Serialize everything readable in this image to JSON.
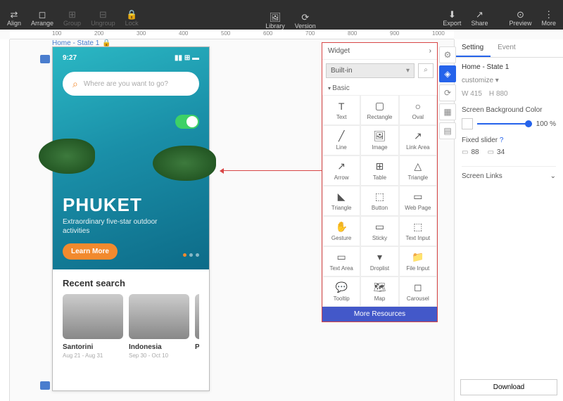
{
  "topbar": {
    "left": [
      {
        "icon": "⇄",
        "label": "Align"
      },
      {
        "icon": "◻",
        "label": "Arrange"
      },
      {
        "icon": "⊞",
        "label": "Group",
        "muted": true
      },
      {
        "icon": "⊟",
        "label": "Ungroup",
        "muted": true
      },
      {
        "icon": "🔒",
        "label": "Lock",
        "muted": true
      }
    ],
    "center": [
      {
        "icon": "🖼",
        "label": "Library"
      },
      {
        "icon": "⟳",
        "label": "Version"
      }
    ],
    "right1": [
      {
        "icon": "⬇",
        "label": "Export"
      },
      {
        "icon": "↗",
        "label": "Share"
      }
    ],
    "right2": [
      {
        "icon": "⊙",
        "label": "Preview"
      },
      {
        "icon": "⋮",
        "label": "More"
      }
    ]
  },
  "ruler_marks": [
    "100",
    "200",
    "300",
    "400",
    "500",
    "600",
    "700",
    "800",
    "900",
    "1000"
  ],
  "breadcrumb": "Home - State 1",
  "phone": {
    "time": "9:27",
    "search_placeholder": "Where are you want to go?",
    "title": "PHUKET",
    "subtitle": "Extraordinary five-star outdoor activities",
    "cta": "Learn More",
    "recent_title": "Recent search",
    "cards": [
      {
        "t": "Santorini",
        "d": "Aug 21 - Aug 31"
      },
      {
        "t": "Indonesia",
        "d": "Sep 30 - Oct 10"
      },
      {
        "t": "Paris",
        "d": ""
      }
    ]
  },
  "widget": {
    "header": "Widget",
    "category": "Built-in",
    "section": "Basic",
    "cells": [
      {
        "i": "T",
        "l": "Text"
      },
      {
        "i": "▢",
        "l": "Rectangle"
      },
      {
        "i": "○",
        "l": "Oval"
      },
      {
        "i": "╱",
        "l": "Line"
      },
      {
        "i": "🖼",
        "l": "Image"
      },
      {
        "i": "↗",
        "l": "Link Area"
      },
      {
        "i": "↗",
        "l": "Arrow"
      },
      {
        "i": "⊞",
        "l": "Table"
      },
      {
        "i": "△",
        "l": "Triangle"
      },
      {
        "i": "◣",
        "l": "Triangle"
      },
      {
        "i": "⬚",
        "l": "Button"
      },
      {
        "i": "▭",
        "l": "Web Page"
      },
      {
        "i": "✋",
        "l": "Gesture"
      },
      {
        "i": "▭",
        "l": "Sticky"
      },
      {
        "i": "⬚",
        "l": "Text Input"
      },
      {
        "i": "▭",
        "l": "Text Area"
      },
      {
        "i": "▾",
        "l": "Droplist"
      },
      {
        "i": "📁",
        "l": "File Input"
      },
      {
        "i": "💬",
        "l": "Tooltip"
      },
      {
        "i": "🗺",
        "l": "Map"
      },
      {
        "i": "◻",
        "l": "Carousel"
      }
    ],
    "more": "More Resources"
  },
  "side_icons": [
    "⚙",
    "◈",
    "⟳",
    "▦",
    "▤"
  ],
  "right_panel": {
    "tabs": [
      "Setting",
      "Event"
    ],
    "title": "Home - State 1",
    "customize": "customize",
    "w_label": "W",
    "w": "415",
    "h_label": "H",
    "h": "880",
    "bg_label": "Screen Background Color",
    "bg_pct": "100 %",
    "fixed_label": "Fixed slider",
    "fixed_top": "88",
    "fixed_bottom": "34",
    "links": "Screen Links",
    "download": "Download"
  }
}
